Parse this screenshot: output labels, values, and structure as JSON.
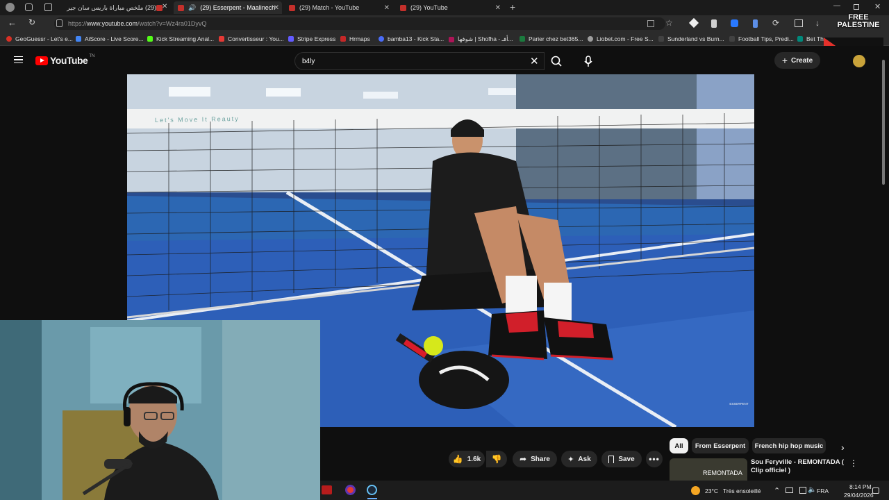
{
  "browser": {
    "tabs": [
      {
        "title": "(29) ملخص مباراة باريس سان جير"
      },
      {
        "title": "(29) Esserpent - Maalinech"
      },
      {
        "title": "(29) Match - YouTube"
      },
      {
        "title": "(29) YouTube"
      }
    ],
    "url_prefix": "https://",
    "url_host": "www.youtube.com",
    "url_path": "/watch?v=Wz4ra01DyvQ",
    "bookmarks": [
      {
        "label": "GeoGuessr - Let's e...",
        "color": "#d93025"
      },
      {
        "label": "AiScore - Live Score...",
        "color": "#4285f4"
      },
      {
        "label": "Kick Streaming Anal...",
        "color": "#53fc18"
      },
      {
        "label": "Convertisseur : You...",
        "color": "#e53935"
      },
      {
        "label": "Stripe Express",
        "color": "#635bff"
      },
      {
        "label": "Hrmaps",
        "color": "#c62828"
      },
      {
        "label": "bamba13 - Kick Sta...",
        "color": "#4a6cf7"
      },
      {
        "label": "شوفها | Shofha - أفـ...",
        "color": "#ad1457"
      },
      {
        "label": "Parier chez bet365...",
        "color": "#1b7a3e"
      },
      {
        "label": "Liobet.com - Free S...",
        "color": "#9e9e9e"
      },
      {
        "label": "Sunderland vs Burn...",
        "color": "#424242"
      },
      {
        "label": "Football Tips, Predi...",
        "color": "#424242"
      },
      {
        "label": "Bet Th",
        "color": "#00897b"
      }
    ],
    "overlay_badge": "FREE PALESTINE"
  },
  "youtube": {
    "logo_text": "YouTube",
    "logo_sup": "TN",
    "search_value": "b4ly",
    "create_label": "Create",
    "like_count": "1.6k",
    "share_label": "Share",
    "ask_label": "Ask",
    "save_label": "Save",
    "chips": [
      "All",
      "From Esserpent",
      "French hip hop music"
    ],
    "related": {
      "title": "Sou Feryville - REMONTADA ( Clip officiel )",
      "thumb_text": "REMONTADA"
    },
    "video_watermark": "ESSERPENT",
    "net_banner": "Let's Move It Reauty"
  },
  "taskbar": {
    "weather_temp": "23°C",
    "weather_desc": "Très ensoleillé",
    "lang": "FRA",
    "time": "8:14 PM",
    "date": "29/04/2026"
  },
  "colors": {
    "yt_red": "#ff0000",
    "court_blue": "#2d5fb8",
    "background": "#0f0f0f"
  }
}
